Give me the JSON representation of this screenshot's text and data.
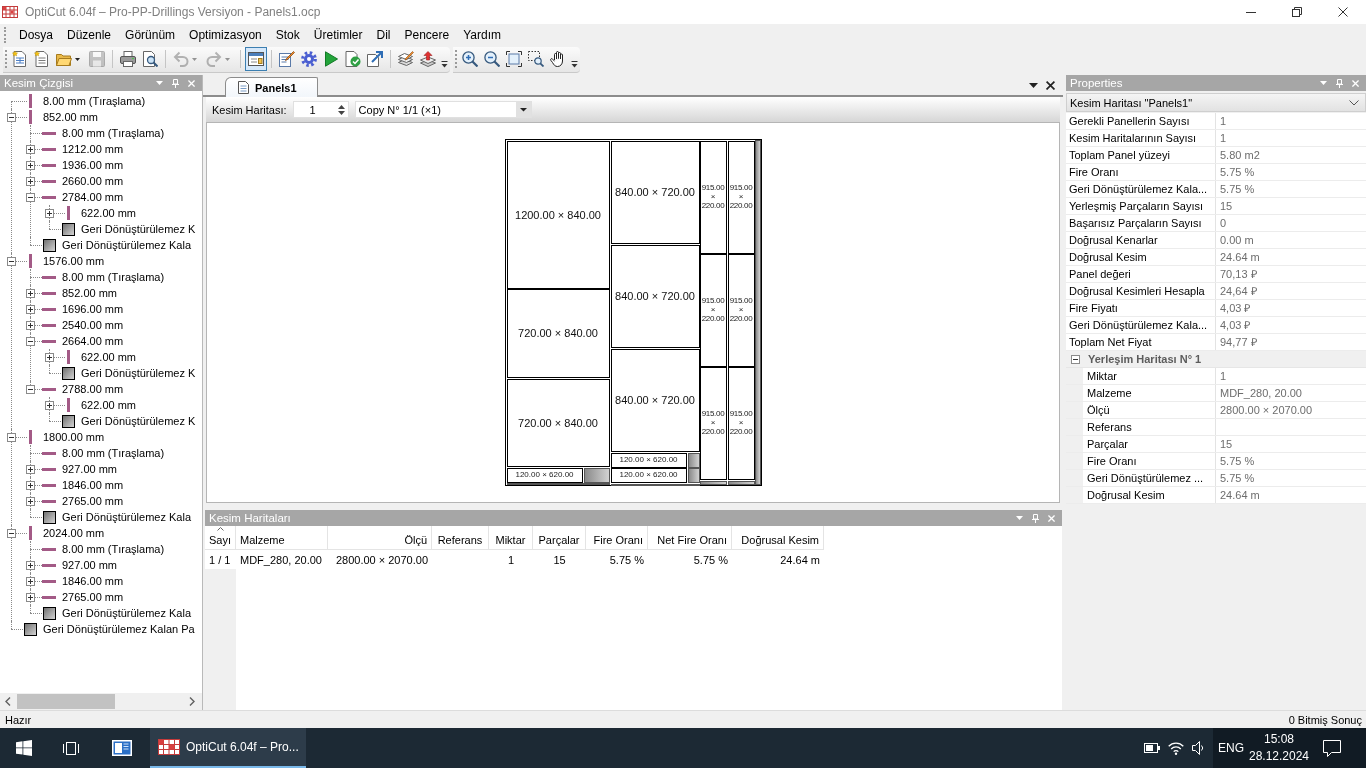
{
  "window": {
    "title": "OptiCut 6.04f – Pro-PP-Drillings Versiyon - Panels1.ocp"
  },
  "menu": [
    "Dosya",
    "Düzenle",
    "Görünüm",
    "Optimizasyon",
    "Stok",
    "Üretimler",
    "Dil",
    "Pencere",
    "Yardım"
  ],
  "toolbars": [
    {
      "buttons": [
        {
          "disabled": false,
          "selected": false
        },
        {
          "disabled": false,
          "selected": false
        },
        {
          "disabled": false,
          "selected": false
        },
        {
          "disabled": true,
          "selected": false
        },
        {
          "disabled": false,
          "selected": false
        },
        {
          "disabled": false,
          "selected": false
        },
        {
          "disabled": true,
          "selected": false
        },
        {
          "disabled": true,
          "selected": false
        },
        {
          "disabled": false,
          "selected": true
        },
        {
          "disabled": false,
          "selected": false
        },
        {
          "disabled": false,
          "selected": false
        },
        {
          "disabled": false,
          "selected": false
        },
        {
          "disabled": false,
          "selected": false
        },
        {
          "disabled": false,
          "selected": false
        },
        {
          "disabled": false,
          "selected": false
        },
        {
          "disabled": false,
          "selected": false
        }
      ]
    },
    {
      "buttons": [
        {
          "disabled": false,
          "selected": false
        },
        {
          "disabled": false,
          "selected": false
        },
        {
          "disabled": false,
          "selected": false
        },
        {
          "disabled": false,
          "selected": false
        },
        {
          "disabled": false,
          "selected": false
        }
      ]
    }
  ],
  "cut_tree": {
    "title": "Kesim Çizgisi",
    "items": [
      {
        "label": "8.00 mm (Tıraşlama)",
        "kind": "vertical_cut",
        "selected": false
      },
      {
        "label": "852.00 mm",
        "kind": "vertical_cut",
        "selected": false,
        "expanded": true,
        "children": [
          {
            "label": "8.00 mm (Tıraşlama)",
            "kind": "horizontal_cut",
            "selected": false
          },
          {
            "label": "1212.00 mm",
            "kind": "horizontal_cut",
            "selected": false,
            "expanded": false
          },
          {
            "label": "1936.00 mm",
            "kind": "horizontal_cut",
            "selected": false,
            "expanded": false
          },
          {
            "label": "2660.00 mm",
            "kind": "horizontal_cut",
            "selected": false,
            "expanded": false
          },
          {
            "label": "2784.00 mm",
            "kind": "horizontal_cut",
            "selected": false,
            "expanded": true,
            "children": [
              {
                "label": "622.00 mm",
                "kind": "vertical_cut",
                "selected": false,
                "expanded": false
              },
              {
                "label": "Geri Dönüştürülemez K",
                "kind": "waste",
                "selected": false
              }
            ]
          },
          {
            "label": "Geri Dönüştürülemez Kala",
            "kind": "waste",
            "selected": false
          }
        ]
      },
      {
        "label": "1576.00 mm",
        "kind": "vertical_cut",
        "selected": false,
        "expanded": true,
        "children": [
          {
            "label": "8.00 mm (Tıraşlama)",
            "kind": "horizontal_cut",
            "selected": false
          },
          {
            "label": "852.00 mm",
            "kind": "horizontal_cut",
            "selected": false,
            "expanded": false
          },
          {
            "label": "1696.00 mm",
            "kind": "horizontal_cut",
            "selected": false,
            "expanded": false
          },
          {
            "label": "2540.00 mm",
            "kind": "horizontal_cut",
            "selected": false,
            "expanded": false
          },
          {
            "label": "2664.00 mm",
            "kind": "horizontal_cut",
            "selected": false,
            "expanded": true,
            "children": [
              {
                "label": "622.00 mm",
                "kind": "vertical_cut",
                "selected": false,
                "expanded": false
              },
              {
                "label": "Geri Dönüştürülemez K",
                "kind": "waste",
                "selected": false
              }
            ]
          },
          {
            "label": "2788.00 mm",
            "kind": "horizontal_cut",
            "selected": false,
            "expanded": true,
            "children": [
              {
                "label": "622.00 mm",
                "kind": "vertical_cut",
                "selected": false,
                "expanded": false
              },
              {
                "label": "Geri Dönüştürülemez K",
                "kind": "waste",
                "selected": false
              }
            ]
          }
        ]
      },
      {
        "label": "1800.00 mm",
        "kind": "vertical_cut",
        "selected": false,
        "expanded": true,
        "children": [
          {
            "label": "8.00 mm (Tıraşlama)",
            "kind": "horizontal_cut",
            "selected": false
          },
          {
            "label": "927.00 mm",
            "kind": "horizontal_cut",
            "selected": false,
            "expanded": false
          },
          {
            "label": "1846.00 mm",
            "kind": "horizontal_cut",
            "selected": false,
            "expanded": false
          },
          {
            "label": "2765.00 mm",
            "kind": "horizontal_cut",
            "selected": false,
            "expanded": false
          },
          {
            "label": "Geri Dönüştürülemez Kala",
            "kind": "waste",
            "selected": false
          }
        ]
      },
      {
        "label": "2024.00 mm",
        "kind": "vertical_cut",
        "selected": false,
        "expanded": true,
        "children": [
          {
            "label": "8.00 mm (Tıraşlama)",
            "kind": "horizontal_cut",
            "selected": false
          },
          {
            "label": "927.00 mm",
            "kind": "horizontal_cut",
            "selected": false,
            "expanded": false
          },
          {
            "label": "1846.00 mm",
            "kind": "horizontal_cut",
            "selected": false,
            "expanded": false
          },
          {
            "label": "2765.00 mm",
            "kind": "horizontal_cut",
            "selected": false,
            "expanded": false
          },
          {
            "label": "Geri Dönüştürülemez Kala",
            "kind": "waste",
            "selected": false
          }
        ]
      },
      {
        "label": "Geri Dönüştürülemez Kalan Pa",
        "kind": "waste",
        "selected": false
      }
    ]
  },
  "editor": {
    "tabs": [
      {
        "label": "Panels1",
        "selected": true
      }
    ],
    "map_label": "Kesim Haritası:",
    "map_number": "1",
    "copy": "Copy N° 1/1 (×1)",
    "pieces": [
      {
        "label": "1200.00 × 840.00"
      },
      {
        "label": "720.00 × 840.00"
      },
      {
        "label": "720.00 × 840.00"
      },
      {
        "label": "120.00 × 620.00"
      },
      {
        "label": "840.00 × 720.00"
      },
      {
        "label": "840.00 × 720.00"
      },
      {
        "label": "840.00 × 720.00"
      },
      {
        "label": "120.00 × 620.00"
      },
      {
        "label": "120.00 × 620.00"
      },
      {
        "label": "915.00 × 220.00"
      },
      {
        "label": "915.00 × 220.00"
      },
      {
        "label": "915.00 × 220.00"
      },
      {
        "label": "915.00 × 220.00"
      },
      {
        "label": "915.00 × 220.00"
      },
      {
        "label": "915.00 × 220.00"
      }
    ]
  },
  "maps_panel": {
    "title": "Kesim Haritaları",
    "columns": [
      {
        "label": "Sayı",
        "sorted": true
      },
      {
        "label": "Malzeme",
        "sorted": false
      },
      {
        "label": "Ölçü",
        "sorted": false
      },
      {
        "label": "Referans",
        "sorted": false
      },
      {
        "label": "Miktar",
        "sorted": false
      },
      {
        "label": "Parçalar",
        "sorted": false
      },
      {
        "label": "Fire Oranı",
        "sorted": false
      },
      {
        "label": "Net Fire Oranı",
        "sorted": false
      },
      {
        "label": "Doğrusal Kesim",
        "sorted": false
      }
    ],
    "rows": [
      {
        "selected": false,
        "cells": [
          "1 / 1",
          "MDF_280, 20.00",
          "2800.00 × 2070.00",
          null,
          "1",
          "15",
          "5.75 %",
          "5.75 %",
          "24.64 m"
        ]
      }
    ]
  },
  "properties": {
    "title": "Properties",
    "object": "Kesim Haritası \"Panels1\"",
    "items": [
      {
        "label": "Gerekli Panellerin Sayısı",
        "value": "1"
      },
      {
        "label": "Kesim Haritalarının Sayısı",
        "value": "1"
      },
      {
        "label": "Toplam Panel yüzeyi",
        "value": "5.80 m2"
      },
      {
        "label": "Fire Oranı",
        "value": "5.75 %"
      },
      {
        "label": "Geri Dönüştürülemez Kala...",
        "value": "5.75 %"
      },
      {
        "label": "Yerleşmiş Parçaların Sayısı",
        "value": "15"
      },
      {
        "label": "Başarısız Parçaların Sayısı",
        "value": "0"
      },
      {
        "label": "Doğrusal Kenarlar",
        "value": "0.00 m"
      },
      {
        "label": "Doğrusal Kesim",
        "value": "24.64 m"
      },
      {
        "label": "Panel değeri",
        "value": "70,13 ₽"
      },
      {
        "label": "Doğrusal Kesimleri Hesapla",
        "value": "24,64 ₽"
      },
      {
        "label": "Fire Fiyatı",
        "value": "4,03 ₽"
      },
      {
        "label": "Geri Dönüştürülemez Kala...",
        "value": "4,03 ₽"
      },
      {
        "label": "Toplam Net Fiyat",
        "value": "94,77 ₽"
      }
    ],
    "groups": [
      {
        "label": "Yerleşim Haritası N° 1",
        "expanded": true,
        "items": [
          {
            "label": "Miktar",
            "value": "1"
          },
          {
            "label": "Malzeme",
            "value": "MDF_280, 20.00"
          },
          {
            "label": "Ölçü",
            "value": "2800.00 × 2070.00"
          },
          {
            "label": "Referans"
          },
          {
            "label": "Parçalar",
            "value": "15"
          },
          {
            "label": "Fire Oranı",
            "value": "5.75 %"
          },
          {
            "label": "Geri Dönüştürülemez ...",
            "value": "5.75 %"
          },
          {
            "label": "Doğrusal Kesim",
            "value": "24.64 m"
          }
        ]
      }
    ]
  },
  "status_bar": {
    "left": "Hazır",
    "right": "0 Bitmiş Sonuç"
  },
  "taskbar": {
    "apps": [
      {
        "label": "OptiCut 6.04f – Pro...",
        "selected": true
      }
    ],
    "language": "ENG",
    "time": "15:08",
    "date": "28.12.2024"
  }
}
